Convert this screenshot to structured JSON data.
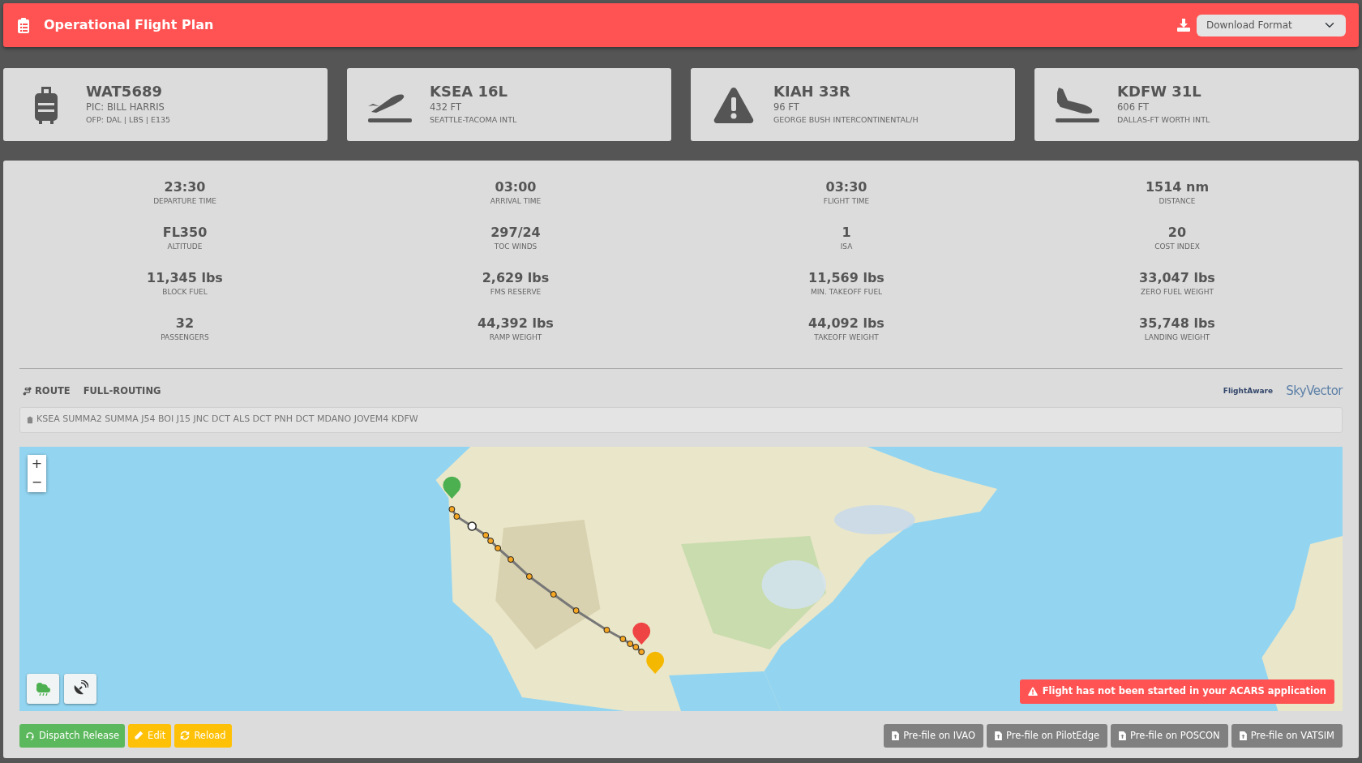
{
  "header": {
    "title": "Operational Flight Plan",
    "download_select": {
      "value": "Download Format"
    }
  },
  "cards": [
    {
      "kind": "flight",
      "title": "WAT5689",
      "line_1": "PIC: BILL HARRIS",
      "line_2": "OFP: DAL | LBS | E135"
    },
    {
      "kind": "departure",
      "title": "KSEA 16L",
      "line_1": "432 FT",
      "line_2": "SEATTLE-TACOMA INTL"
    },
    {
      "kind": "alternate",
      "title": "KIAH 33R",
      "line_1": "96 FT",
      "line_2": "GEORGE BUSH INTERCONTINENTAL/H"
    },
    {
      "kind": "arrival",
      "title": "KDFW 31L",
      "line_1": "606 FT",
      "line_2": "DALLAS-FT WORTH INTL"
    }
  ],
  "stats": [
    {
      "value": "23:30",
      "label": "DEPARTURE TIME"
    },
    {
      "value": "03:00",
      "label": "ARRIVAL TIME"
    },
    {
      "value": "03:30",
      "label": "FLIGHT TIME"
    },
    {
      "value": "1514 nm",
      "label": "DISTANCE"
    },
    {
      "value": "FL350",
      "label": "ALTITUDE"
    },
    {
      "value": "297/24",
      "label": "TOC WINDS"
    },
    {
      "value": "1",
      "label": "ISA"
    },
    {
      "value": "20",
      "label": "COST INDEX"
    },
    {
      "value": "11,345 lbs",
      "label": "BLOCK FUEL"
    },
    {
      "value": "2,629 lbs",
      "label": "FMS RESERVE"
    },
    {
      "value": "11,569 lbs",
      "label": "MIN. TAKEOFF FUEL"
    },
    {
      "value": "33,047 lbs",
      "label": "ZERO FUEL WEIGHT"
    },
    {
      "value": "32",
      "label": "PASSENGERS"
    },
    {
      "value": "44,392 lbs",
      "label": "RAMP WEIGHT"
    },
    {
      "value": "44,092 lbs",
      "label": "TAKEOFF WEIGHT"
    },
    {
      "value": "35,748 lbs",
      "label": "LANDING WEIGHT"
    }
  ],
  "route": {
    "tabs": [
      {
        "label": "ROUTE",
        "kind": "icon"
      },
      {
        "label": "FULL-ROUTING",
        "kind": "plain"
      }
    ],
    "partners": [
      "FlightAware",
      "SkyVector"
    ],
    "string": "KSEA SUMMA2 SUMMA J54 BOI J15 JNC DCT ALS DCT PNH DCT MDANO JOVEM4 KDFW"
  },
  "map": {
    "zoom_buttons": [
      "+",
      "−"
    ],
    "alert": "Flight has not been started in your ACARS application"
  },
  "actions": [
    {
      "label": "Dispatch Release",
      "kind": "dispatch"
    },
    {
      "label": "Edit",
      "kind": "edit"
    },
    {
      "label": "Reload",
      "kind": "reload"
    }
  ],
  "prefile": [
    "Pre-file on IVAO",
    "Pre-file on PilotEdge",
    "Pre-file on POSCON",
    "Pre-file on VATSIM"
  ]
}
